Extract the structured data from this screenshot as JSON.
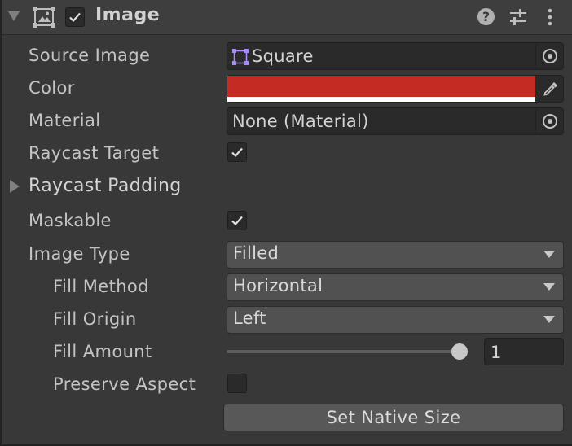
{
  "component": {
    "title": "Image",
    "enabled": true,
    "icons": {
      "fold": "triangle-down-icon",
      "component": "image-component-icon",
      "help": "help-icon",
      "presets": "presets-sliders-icon",
      "menu": "kebab-menu-icon"
    },
    "help_glyph": "?"
  },
  "fields": {
    "source_image": {
      "label": "Source Image",
      "value": "Square"
    },
    "color": {
      "label": "Color",
      "value": "#c42b22"
    },
    "material": {
      "label": "Material",
      "value": "None (Material)"
    },
    "raycast_target": {
      "label": "Raycast Target",
      "checked": true
    },
    "raycast_padding": {
      "label": "Raycast Padding"
    },
    "maskable": {
      "label": "Maskable",
      "checked": true
    },
    "image_type": {
      "label": "Image Type",
      "value": "Filled"
    },
    "fill_method": {
      "label": "Fill Method",
      "value": "Horizontal"
    },
    "fill_origin": {
      "label": "Fill Origin",
      "value": "Left"
    },
    "fill_amount": {
      "label": "Fill Amount",
      "value": "1",
      "fraction": 1
    },
    "preserve_aspect": {
      "label": "Preserve Aspect",
      "checked": false
    }
  },
  "buttons": {
    "set_native_size": "Set Native Size"
  },
  "colors": {
    "panel_bg": "#383838",
    "field_bg": "#2a2a2a",
    "dropdown_bg": "#515151",
    "accent_purple": "#a78bfa",
    "color_swatch": "#c42b22"
  }
}
